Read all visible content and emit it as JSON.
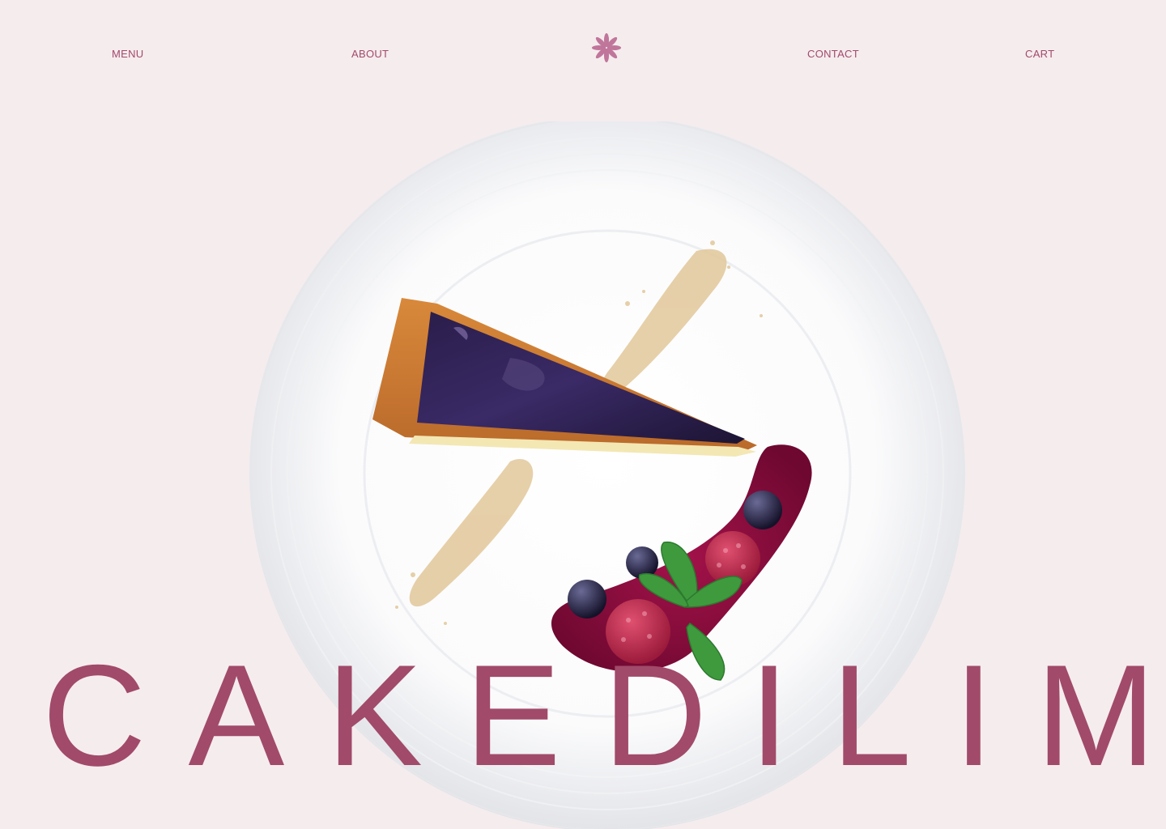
{
  "nav": {
    "menu_label": "MENU",
    "about_label": "ABOUT",
    "contact_label": "CONTACT",
    "cart_label": "CART",
    "logo_icon": "flower-asterisk-icon"
  },
  "hero": {
    "image_subject": "cheesecake-slice-with-berry-sauce-on-plate",
    "wordmark": "CAKEDILIM"
  },
  "colors": {
    "background": "#f5ecee",
    "accent": "#a14a69"
  }
}
